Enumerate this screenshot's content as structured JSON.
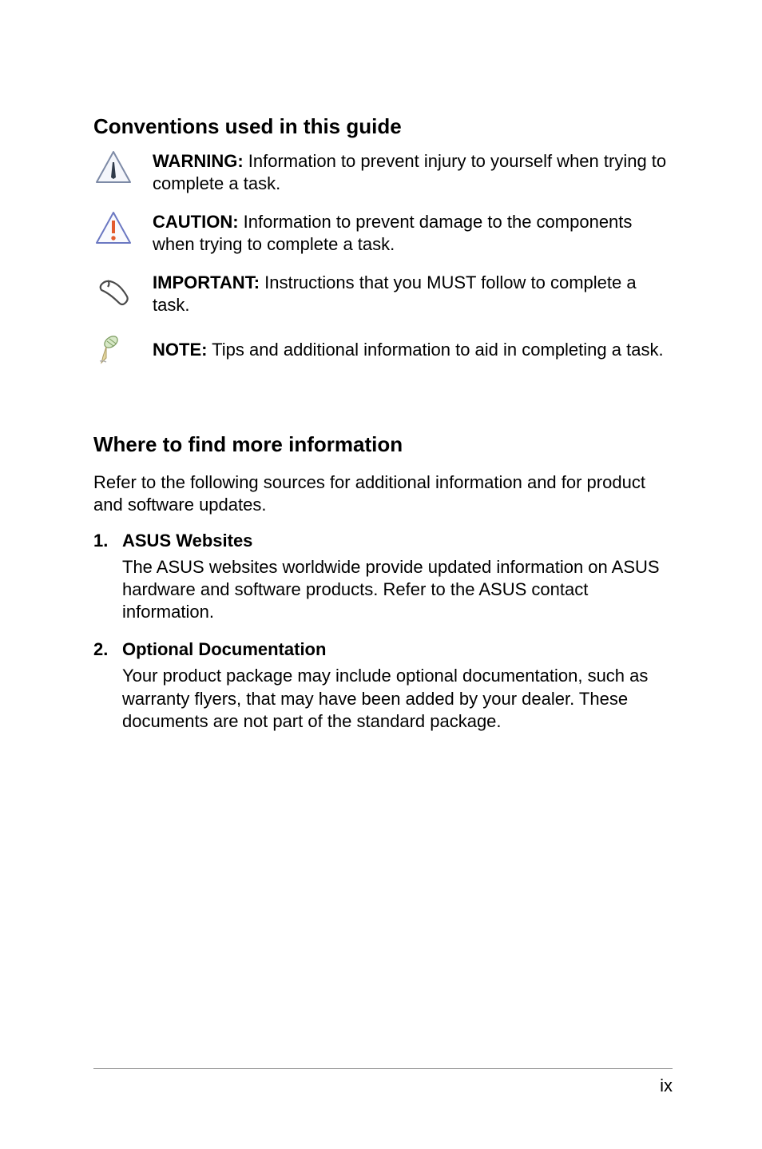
{
  "section1": {
    "heading": "Conventions used in this guide",
    "items": [
      {
        "label": "WARNING:",
        "text": " Information to prevent injury to yourself when trying to complete a task."
      },
      {
        "label": "CAUTION:",
        "text": " Information to prevent damage to the components when trying to complete a task."
      },
      {
        "label": "IMPORTANT:",
        "text": " Instructions that you MUST follow to complete a task."
      },
      {
        "label": "NOTE:",
        "text": " Tips and additional information to aid in completing a task."
      }
    ]
  },
  "section2": {
    "heading": "Where to find more information",
    "intro": "Refer to the following sources for additional information and for product and software updates.",
    "items": [
      {
        "num": "1.",
        "title": "ASUS Websites",
        "desc": "The ASUS websites worldwide provide updated information on ASUS hardware and software products. Refer to the ASUS contact information."
      },
      {
        "num": "2.",
        "title": "Optional Documentation",
        "desc": "Your product package may include optional documentation, such as warranty flyers, that may have been added by your dealer. These documents are not part of the standard package."
      }
    ]
  },
  "page_number": "ix"
}
